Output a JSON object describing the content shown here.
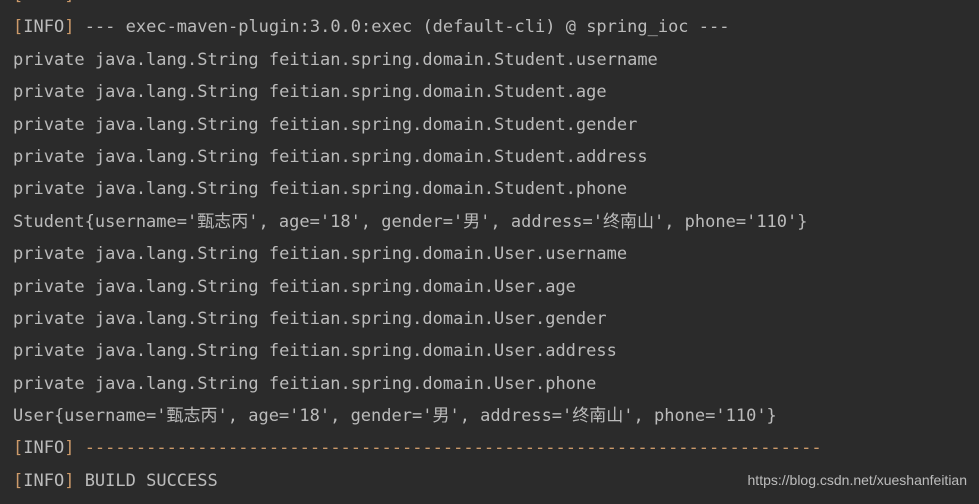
{
  "console": {
    "background_color": "#2b2b2b",
    "text_color": "#bbbbbb",
    "accent_color": "#cc9a6a",
    "lines": [
      {
        "id": "line-0",
        "type": "info-clipped",
        "prefix": "[INFO]",
        "text": "",
        "clipped": true
      },
      {
        "id": "line-1",
        "type": "info",
        "prefix": "[INFO]",
        "text": " --- exec-maven-plugin:3.0.0:exec (default-cli) @ spring_ioc ---"
      },
      {
        "id": "line-2",
        "type": "plain",
        "prefix": "",
        "text": "private java.lang.String feitian.spring.domain.Student.username"
      },
      {
        "id": "line-3",
        "type": "plain",
        "prefix": "",
        "text": "private java.lang.String feitian.spring.domain.Student.age"
      },
      {
        "id": "line-4",
        "type": "plain",
        "prefix": "",
        "text": "private java.lang.String feitian.spring.domain.Student.gender"
      },
      {
        "id": "line-5",
        "type": "plain",
        "prefix": "",
        "text": "private java.lang.String feitian.spring.domain.Student.address"
      },
      {
        "id": "line-6",
        "type": "plain",
        "prefix": "",
        "text": "private java.lang.String feitian.spring.domain.Student.phone"
      },
      {
        "id": "line-7",
        "type": "plain",
        "prefix": "",
        "text": "Student{username='甄志丙', age='18', gender='男', address='终南山', phone='110'}"
      },
      {
        "id": "line-8",
        "type": "plain",
        "prefix": "",
        "text": "private java.lang.String feitian.spring.domain.User.username"
      },
      {
        "id": "line-9",
        "type": "plain",
        "prefix": "",
        "text": "private java.lang.String feitian.spring.domain.User.age"
      },
      {
        "id": "line-10",
        "type": "plain",
        "prefix": "",
        "text": "private java.lang.String feitian.spring.domain.User.gender"
      },
      {
        "id": "line-11",
        "type": "plain",
        "prefix": "",
        "text": "private java.lang.String feitian.spring.domain.User.address"
      },
      {
        "id": "line-12",
        "type": "plain",
        "prefix": "",
        "text": "private java.lang.String feitian.spring.domain.User.phone"
      },
      {
        "id": "line-13",
        "type": "plain",
        "prefix": "",
        "text": "User{username='甄志丙', age='18', gender='男', address='终南山', phone='110'}"
      },
      {
        "id": "line-14",
        "type": "separator",
        "prefix": "[INFO]",
        "text": " ------------------------------------------------------------------------"
      },
      {
        "id": "line-15",
        "type": "info",
        "prefix": "[INFO]",
        "text": " BUILD SUCCESS"
      }
    ]
  },
  "watermark": {
    "text": "https://blog.csdn.net/xueshanfeitian"
  }
}
